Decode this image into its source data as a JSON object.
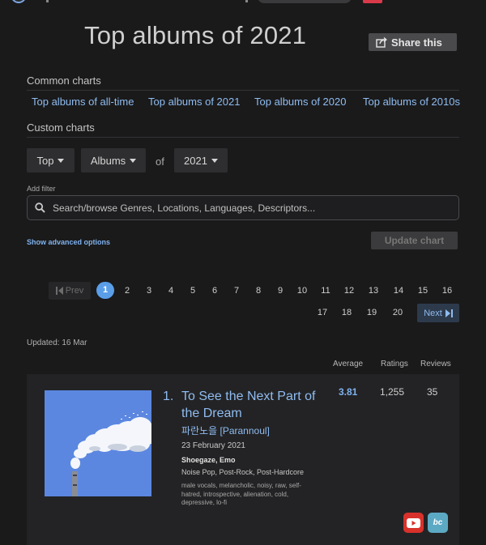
{
  "header": {
    "title": "Top albums of 2021",
    "share_label": "Share this"
  },
  "common_charts": {
    "label": "Common charts",
    "links": [
      "Top albums of all-time",
      "Top albums of 2021",
      "Top albums of 2020",
      "Top albums of 2010s"
    ]
  },
  "custom_charts": {
    "label": "Custom charts",
    "type": "Top",
    "category": "Albums",
    "of_label": "of",
    "year": "2021"
  },
  "filter": {
    "label": "Add filter",
    "placeholder": "Search/browse Genres, Locations, Languages, Descriptors..."
  },
  "advanced_label": "Show advanced options",
  "update_label": "Update chart",
  "pagination": {
    "prev_label": "Prev",
    "next_label": "Next",
    "current": "1",
    "row1": [
      "2",
      "3",
      "4",
      "5",
      "6",
      "7",
      "8",
      "9",
      "10",
      "11",
      "12",
      "13",
      "14",
      "15",
      "16"
    ],
    "row2": [
      "17",
      "18",
      "19",
      "20"
    ]
  },
  "updated": "Updated: 16 Mar",
  "columns": {
    "average": "Average",
    "ratings": "Ratings",
    "reviews": "Reviews"
  },
  "entry": {
    "rank": "1.",
    "title": "To See the Next Part of the Dream",
    "artist": "파란노을 [Parannoul]",
    "release_date": "23 February 2021",
    "genre1": "Shoegaze",
    "genre_sep": ", ",
    "genre2": "Emo",
    "secondary_genres": "Noise Pop, Post-Rock, Post-Hardcore",
    "descriptors": "male vocals, melancholic, noisy, raw, self-hatred, introspective, alienation, cold, depressive, lo-fi",
    "average": "3.81",
    "ratings": "1,255",
    "reviews": "35",
    "bc_label": "bc"
  },
  "colors": {
    "background": "#1a1a1b",
    "link": "#8fbcf0",
    "accent": "#5a9ee8",
    "card": "#232325"
  }
}
